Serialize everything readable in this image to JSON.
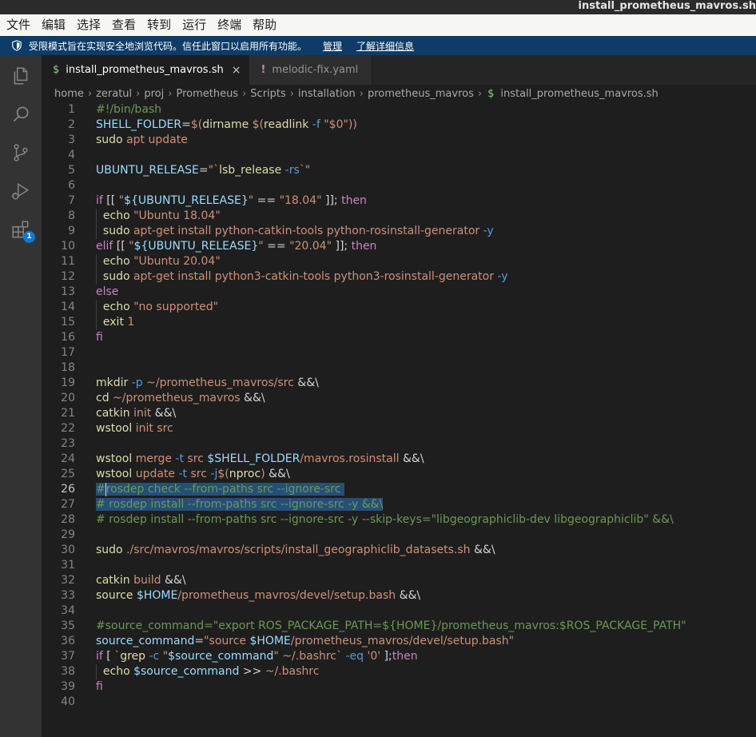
{
  "window": {
    "title": "install_prometheus_mavros.sh"
  },
  "menu": [
    "文件",
    "编辑",
    "选择",
    "查看",
    "转到",
    "运行",
    "终端",
    "帮助"
  ],
  "banner": {
    "message": "受限模式旨在实现安全地浏览代码。信任此窗口以启用所有功能。",
    "manage_link": "管理",
    "learn_more_link": "了解详细信息",
    "color": "#0e3b67"
  },
  "activity_bar": {
    "items": [
      "explorer-icon",
      "search-icon",
      "source-control-icon",
      "run-debug-icon",
      "extensions-icon"
    ],
    "extensions_badge": "1"
  },
  "tabs": [
    {
      "icon": "$",
      "label": "install_prometheus_mavros.sh",
      "active": true,
      "close": "×"
    },
    {
      "icon": "!",
      "label": "melodic-fix.yaml",
      "active": false
    }
  ],
  "breadcrumb": {
    "parts": [
      "home",
      "zeratul",
      "proj",
      "Prometheus",
      "Scripts",
      "installation",
      "prometheus_mavros"
    ],
    "file_icon": "$",
    "file": "install_prometheus_mavros.sh",
    "separator": "›"
  },
  "editor": {
    "current_line": 26,
    "lines": [
      [
        [
          "cm",
          "#!/bin/bash"
        ]
      ],
      [
        [
          "var",
          "SHELL_FOLDER"
        ],
        [
          "op",
          "="
        ],
        [
          "str",
          "$("
        ],
        [
          "fn",
          "dirname"
        ],
        [
          "str",
          " $("
        ],
        [
          "fn",
          "readlink"
        ],
        [
          "fl",
          " -f"
        ],
        [
          "str",
          " \"$0\"))"
        ]
      ],
      [
        [
          "fn",
          "sudo"
        ],
        [
          "str",
          " apt update"
        ]
      ],
      [],
      [
        [
          "var",
          "UBUNTU_RELEASE"
        ],
        [
          "op",
          "="
        ],
        [
          "str",
          "\"`"
        ],
        [
          "fn",
          "lsb_release"
        ],
        [
          "fl",
          " -rs"
        ],
        [
          "str",
          "`\""
        ]
      ],
      [],
      [
        [
          "kw",
          "if"
        ],
        [
          "op",
          " [[ "
        ],
        [
          "str",
          "\""
        ],
        [
          "var",
          "${UBUNTU_RELEASE}"
        ],
        [
          "str",
          "\""
        ],
        [
          "op",
          " == "
        ],
        [
          "str",
          "\"18.04\""
        ],
        [
          "op",
          " ]]; "
        ],
        [
          "kw",
          "then"
        ]
      ],
      [
        [
          "op",
          "  "
        ],
        [
          "fn",
          "echo"
        ],
        [
          "str",
          " \"Ubuntu 18.04\""
        ]
      ],
      [
        [
          "op",
          "  "
        ],
        [
          "fn",
          "sudo"
        ],
        [
          "str",
          " apt-get install python-catkin-tools python-rosinstall-generator"
        ],
        [
          "fl",
          " -y"
        ]
      ],
      [
        [
          "kw",
          "elif"
        ],
        [
          "op",
          " [[ "
        ],
        [
          "str",
          "\""
        ],
        [
          "var",
          "${UBUNTU_RELEASE}"
        ],
        [
          "str",
          "\""
        ],
        [
          "op",
          " == "
        ],
        [
          "str",
          "\"20.04\""
        ],
        [
          "op",
          " ]]; "
        ],
        [
          "kw",
          "then"
        ]
      ],
      [
        [
          "op",
          "  "
        ],
        [
          "fn",
          "echo"
        ],
        [
          "str",
          " \"Ubuntu 20.04\""
        ]
      ],
      [
        [
          "op",
          "  "
        ],
        [
          "fn",
          "sudo"
        ],
        [
          "str",
          " apt-get install python3-catkin-tools python3-rosinstall-generator"
        ],
        [
          "fl",
          " -y"
        ]
      ],
      [
        [
          "kw",
          "else"
        ]
      ],
      [
        [
          "op",
          "  "
        ],
        [
          "fn",
          "echo"
        ],
        [
          "str",
          " \"no supported\""
        ]
      ],
      [
        [
          "op",
          "  "
        ],
        [
          "fn",
          "exit"
        ],
        [
          "str",
          " 1"
        ]
      ],
      [
        [
          "kw",
          "fi"
        ]
      ],
      [],
      [],
      [
        [
          "fn",
          "mkdir"
        ],
        [
          "fl",
          " -p"
        ],
        [
          "str",
          " ~/prometheus_mavros/src"
        ],
        [
          "op",
          " &&\\"
        ]
      ],
      [
        [
          "fn",
          "cd"
        ],
        [
          "str",
          " ~/prometheus_mavros"
        ],
        [
          "op",
          " &&\\"
        ]
      ],
      [
        [
          "fn",
          "catkin"
        ],
        [
          "str",
          " init"
        ],
        [
          "op",
          " &&\\"
        ]
      ],
      [
        [
          "fn",
          "wstool"
        ],
        [
          "str",
          " init src"
        ]
      ],
      [],
      [
        [
          "fn",
          "wstool"
        ],
        [
          "str",
          " merge"
        ],
        [
          "fl",
          " -t"
        ],
        [
          "str",
          " src "
        ],
        [
          "var",
          "$SHELL_FOLDER"
        ],
        [
          "str",
          "/mavros.rosinstall"
        ],
        [
          "op",
          " &&\\"
        ]
      ],
      [
        [
          "fn",
          "wstool"
        ],
        [
          "str",
          " update"
        ],
        [
          "fl",
          " -t"
        ],
        [
          "str",
          " src"
        ],
        [
          "fl",
          " -j"
        ],
        [
          "str",
          "$("
        ],
        [
          "fn",
          "nproc"
        ],
        [
          "str",
          ")"
        ],
        [
          "op",
          " &&\\"
        ]
      ],
      [
        [
          "cm",
          "#"
        ],
        [
          "cursor",
          ""
        ],
        [
          "cm",
          "rosdep check --from-paths src --ignore-src "
        ]
      ],
      [
        [
          "cm",
          "# rosdep install --from-paths src --ignore-src -y &&\\"
        ]
      ],
      [
        [
          "cm",
          "# rosdep install --from-paths src --ignore-src -y --skip-keys=\"libgeographiclib-dev libgeographiclib\" &&\\"
        ]
      ],
      [],
      [
        [
          "fn",
          "sudo"
        ],
        [
          "str",
          " ./src/mavros/mavros/scripts/install_geographiclib_datasets.sh"
        ],
        [
          "op",
          " &&\\"
        ]
      ],
      [],
      [
        [
          "fn",
          "catkin"
        ],
        [
          "str",
          " build"
        ],
        [
          "op",
          " &&\\"
        ]
      ],
      [
        [
          "fn",
          "source"
        ],
        [
          "str",
          " "
        ],
        [
          "var",
          "$HOME"
        ],
        [
          "str",
          "/prometheus_mavros/devel/setup.bash"
        ],
        [
          "op",
          " &&\\"
        ]
      ],
      [],
      [
        [
          "cm",
          "#source_command=\"export ROS_PACKAGE_PATH=${HOME}/prometheus_mavros:$ROS_PACKAGE_PATH\""
        ]
      ],
      [
        [
          "var",
          "source_command"
        ],
        [
          "op",
          "="
        ],
        [
          "str",
          "\"source "
        ],
        [
          "var",
          "$HOME"
        ],
        [
          "str",
          "/prometheus_mavros/devel/setup.bash\""
        ]
      ],
      [
        [
          "kw",
          "if"
        ],
        [
          "op",
          " [ "
        ],
        [
          "str",
          "`"
        ],
        [
          "fn",
          "grep"
        ],
        [
          "fl",
          " -c"
        ],
        [
          "str",
          " \""
        ],
        [
          "var",
          "$source_command"
        ],
        [
          "str",
          "\""
        ],
        [
          "str",
          " ~/.bashrc`"
        ],
        [
          "fl",
          " -eq"
        ],
        [
          "str",
          " '0'"
        ],
        [
          "op",
          " ];"
        ],
        [
          "kw",
          "then"
        ]
      ],
      [
        [
          "op",
          "  "
        ],
        [
          "fn",
          "echo"
        ],
        [
          "str",
          " "
        ],
        [
          "var",
          "$source_command"
        ],
        [
          "op",
          " >> "
        ],
        [
          "str",
          "~/.bashrc"
        ]
      ],
      [
        [
          "kw",
          "fi"
        ]
      ],
      []
    ]
  }
}
